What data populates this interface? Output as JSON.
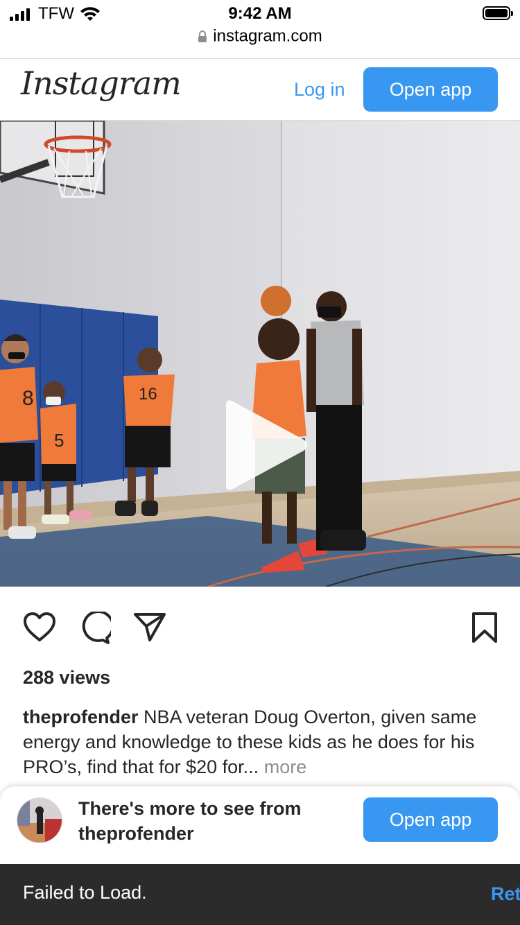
{
  "status_bar": {
    "carrier": "TFW",
    "time": "9:42 AM",
    "url": "instagram.com"
  },
  "header": {
    "logo": "Instagram",
    "login_label": "Log in",
    "open_app_label": "Open app"
  },
  "post": {
    "views": "288 views",
    "username": "theprofender",
    "caption": "NBA veteran Doug Overton, given same energy and knowledge to these kids as he does for his PRO’s, find that for $20 for...",
    "more_label": "more",
    "jersey_numbers": [
      "8",
      "5",
      "16"
    ]
  },
  "sheet": {
    "line1": "There's more to see from",
    "line2": "theprofender",
    "open_app_label": "Open app"
  },
  "toast": {
    "message": "Failed to Load.",
    "action_label": "Ret"
  },
  "colors": {
    "accent": "#3897f0",
    "text": "#262626",
    "muted": "#8e8e8e",
    "toast_bg": "#2b2b2b"
  },
  "icons": [
    "signal-icon",
    "wifi-icon",
    "battery-icon",
    "lock-icon",
    "play-icon",
    "heart-icon",
    "comment-icon",
    "share-icon",
    "bookmark-icon"
  ]
}
